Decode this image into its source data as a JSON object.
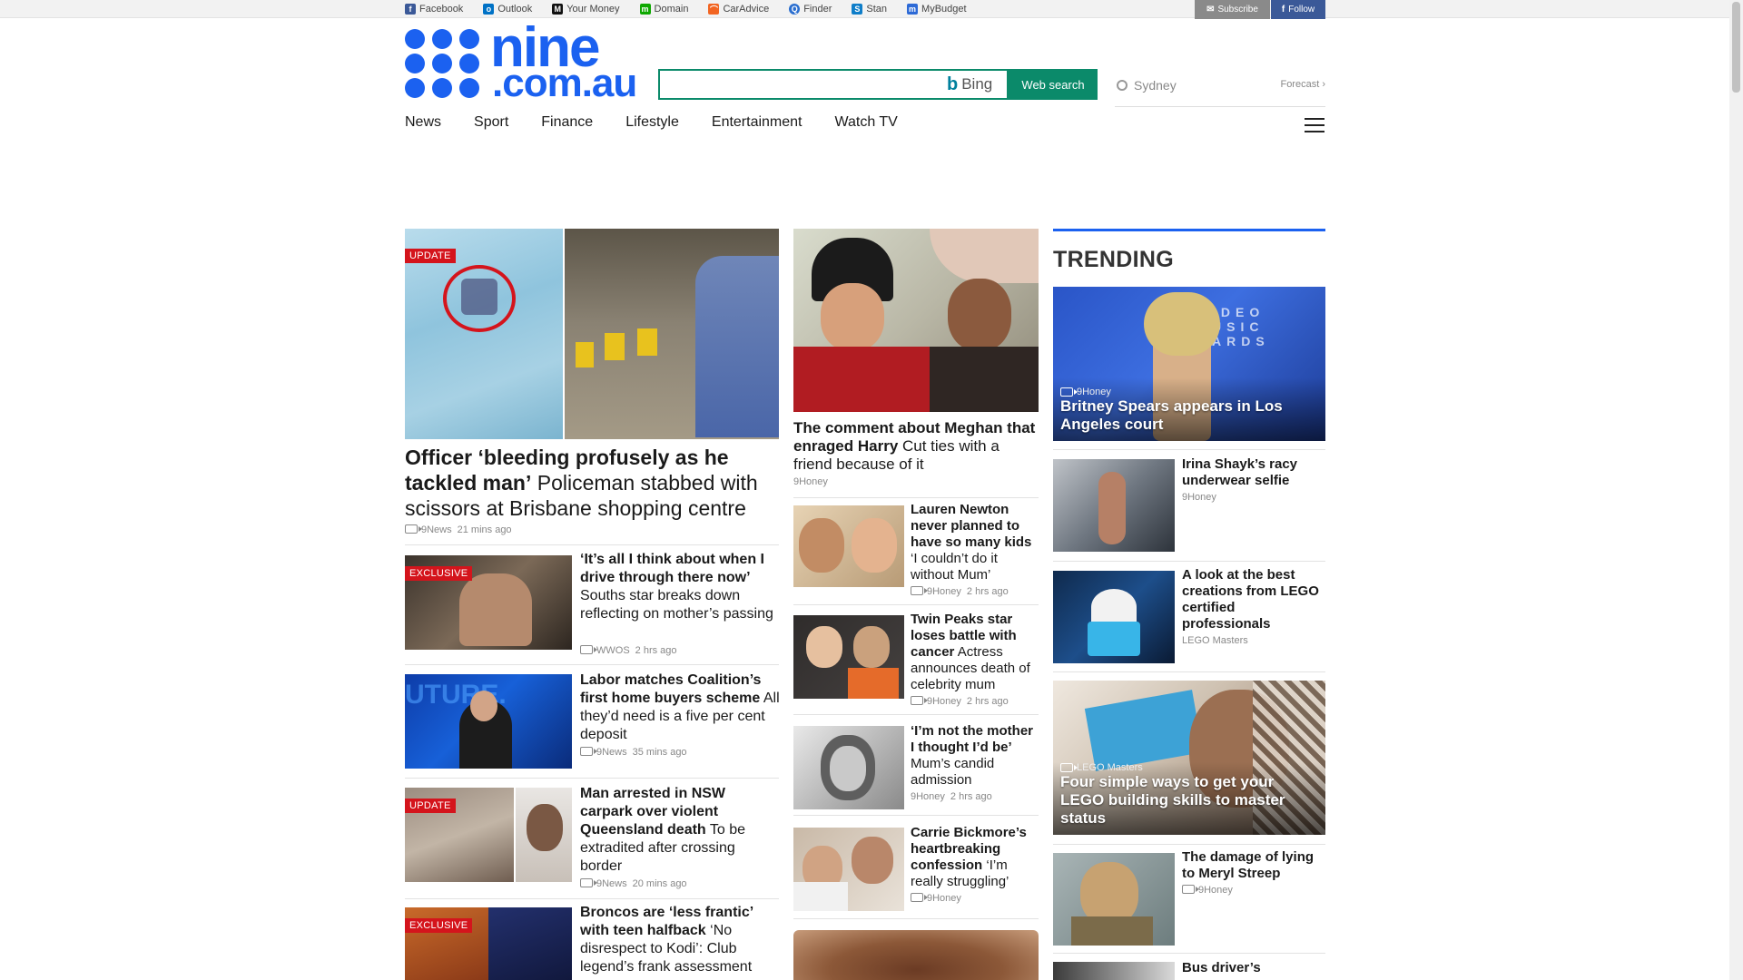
{
  "topbar": {
    "partners": [
      {
        "label": "Facebook",
        "color": "#3b5998",
        "glyph": "f"
      },
      {
        "label": "Outlook",
        "color": "#0072c6",
        "glyph": "o"
      },
      {
        "label": "Your Money",
        "color": "#111111",
        "glyph": "M"
      },
      {
        "label": "Domain",
        "color": "#0ea800",
        "glyph": "m"
      },
      {
        "label": "CarAdvice",
        "color": "#f26522",
        "glyph": "⌒"
      },
      {
        "label": "Finder",
        "color": "#2a6ecf",
        "glyph": "Q"
      },
      {
        "label": "Stan",
        "color": "#0f7ec9",
        "glyph": "S"
      },
      {
        "label": "MyBudget",
        "color": "#2d6ad6",
        "glyph": "m"
      }
    ],
    "subscribe_label": "Subscribe",
    "follow_label": "Follow"
  },
  "logo": {
    "big": "nine",
    "small": ".com.au"
  },
  "search": {
    "placeholder": "",
    "bing_label": "Bing",
    "button_label": "Web search"
  },
  "weather": {
    "city": "Sydney",
    "forecast_label": "Forecast"
  },
  "nav": [
    "News",
    "Sport",
    "Finance",
    "Lifestyle",
    "Entertainment",
    "Watch TV"
  ],
  "feature": {
    "badge": "UPDATE",
    "headline_bold": "Officer ‘bleeding profusely as he tackled man’",
    "headline_rest": " Policeman stabbed with scissors at Brisbane shopping centre",
    "source": "9News",
    "time": "21 mins ago"
  },
  "left_stories": [
    {
      "badge": "EXCLUSIVE",
      "bold": "‘It’s all I think about when I drive through there now’",
      "rest": " Souths star breaks down reflecting on mother’s passing",
      "source": "WWOS",
      "time": "2 hrs ago"
    },
    {
      "badge": "",
      "bold": "Labor matches Coalition’s first home buyers scheme",
      "rest": " All they’d need is a five per cent deposit",
      "source": "9News",
      "time": "35 mins ago"
    },
    {
      "badge": "UPDATE",
      "bold": "Man arrested in NSW carpark over violent Queensland death",
      "rest": " To be extradited after crossing border",
      "source": "9News",
      "time": "20 mins ago"
    },
    {
      "badge": "EXCLUSIVE",
      "bold": "Broncos are ‘less frantic’ with teen halfback",
      "rest": " ‘No disrespect to Kodi’: Club legend’s frank assessment",
      "source": "",
      "time": ""
    }
  ],
  "mid_lead": {
    "bold": "The comment about Meghan that enraged Harry",
    "rest": " Cut ties with a friend because of it",
    "source": "9Honey"
  },
  "mid_stories": [
    {
      "bold": "Lauren Newton never planned to have so many kids",
      "rest": " ‘I couldn’t do it without Mum’",
      "source": "9Honey",
      "time": "2 hrs ago",
      "video": true
    },
    {
      "bold": "Twin Peaks star loses battle with cancer",
      "rest": " Actress announces death of celebrity mum",
      "source": "9Honey",
      "time": "2 hrs ago",
      "video": true
    },
    {
      "bold": "‘I’m not the mother I thought I’d be’",
      "rest": " Mum’s candid admission",
      "source": "9Honey",
      "time": "2 hrs ago",
      "video": false
    },
    {
      "bold": "Carrie Bickmore’s heartbreaking confession",
      "rest": " ‘I’m really struggling’",
      "source": "9Honey",
      "time": "",
      "video": true
    }
  ],
  "trending": {
    "title": "TRENDING",
    "big1": {
      "source": "9Honey",
      "headline": "Britney Spears appears in Los Angeles court"
    },
    "items": [
      {
        "headline": "Irina Shayk’s racy underwear selfie",
        "source": "9Honey",
        "video": false
      },
      {
        "headline": "A look at the best creations from LEGO certified professionals",
        "source": "LEGO Masters",
        "video": false
      }
    ],
    "big2": {
      "source": "LEGO Masters",
      "headline": "Four simple ways to get your LEGO building skills to master status"
    },
    "items2": [
      {
        "headline": "The damage of lying to Meryl Streep",
        "source": "9Honey",
        "video": true
      },
      {
        "headline": "Bus driver’s",
        "source": "",
        "video": false
      }
    ]
  },
  "colors": {
    "brand": "#1b61f0",
    "search_green": "#0b8a6a",
    "badge_red": "#d4141c",
    "facebook": "#3b5998"
  }
}
